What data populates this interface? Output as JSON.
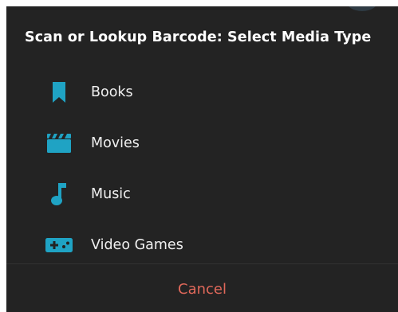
{
  "dialog": {
    "title": "Scan or Lookup Barcode: Select Media Type",
    "items": [
      {
        "label": "Books",
        "icon": "bookmark-icon"
      },
      {
        "label": "Movies",
        "icon": "clapperboard-icon"
      },
      {
        "label": "Music",
        "icon": "music-note-icon"
      },
      {
        "label": "Video Games",
        "icon": "gamepad-icon"
      }
    ],
    "cancel_label": "Cancel"
  },
  "colors": {
    "background": "#232323",
    "accent_icon": "#1fa3c4",
    "cancel_text": "#e0685a",
    "text": "#f0f0f0"
  }
}
